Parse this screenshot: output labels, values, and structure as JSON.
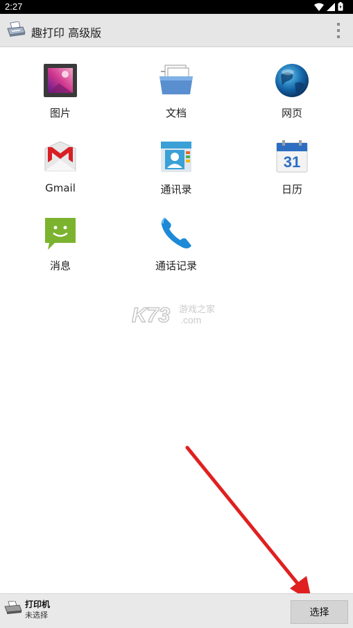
{
  "status_bar": {
    "time": "2:27",
    "icons": [
      "wifi-icon",
      "signal-icon",
      "battery-icon"
    ]
  },
  "app_bar": {
    "title": "趣打印 高级版",
    "app_icon": "printer-app-icon",
    "menu_icon": "overflow-menu-icon"
  },
  "tiles": [
    {
      "label": "图片",
      "icon": "pictures-icon"
    },
    {
      "label": "文档",
      "icon": "documents-folder-icon"
    },
    {
      "label": "网页",
      "icon": "web-globe-icon"
    },
    {
      "label": "Gmail",
      "icon": "gmail-icon"
    },
    {
      "label": "通讯录",
      "icon": "contacts-icon"
    },
    {
      "label": "日历",
      "icon": "calendar-icon"
    },
    {
      "label": "消息",
      "icon": "messages-icon"
    },
    {
      "label": "通话记录",
      "icon": "phone-icon"
    }
  ],
  "calendar_day": "31",
  "watermark": {
    "text_main": "K73",
    "text_cn": "游戏之家",
    "text_domain": ".com"
  },
  "bottom_bar": {
    "printer_title": "打印机",
    "printer_status": "未选择",
    "select_label": "选择"
  },
  "colors": {
    "arrow": "#e02020",
    "appbar": "#e6e6e6"
  }
}
